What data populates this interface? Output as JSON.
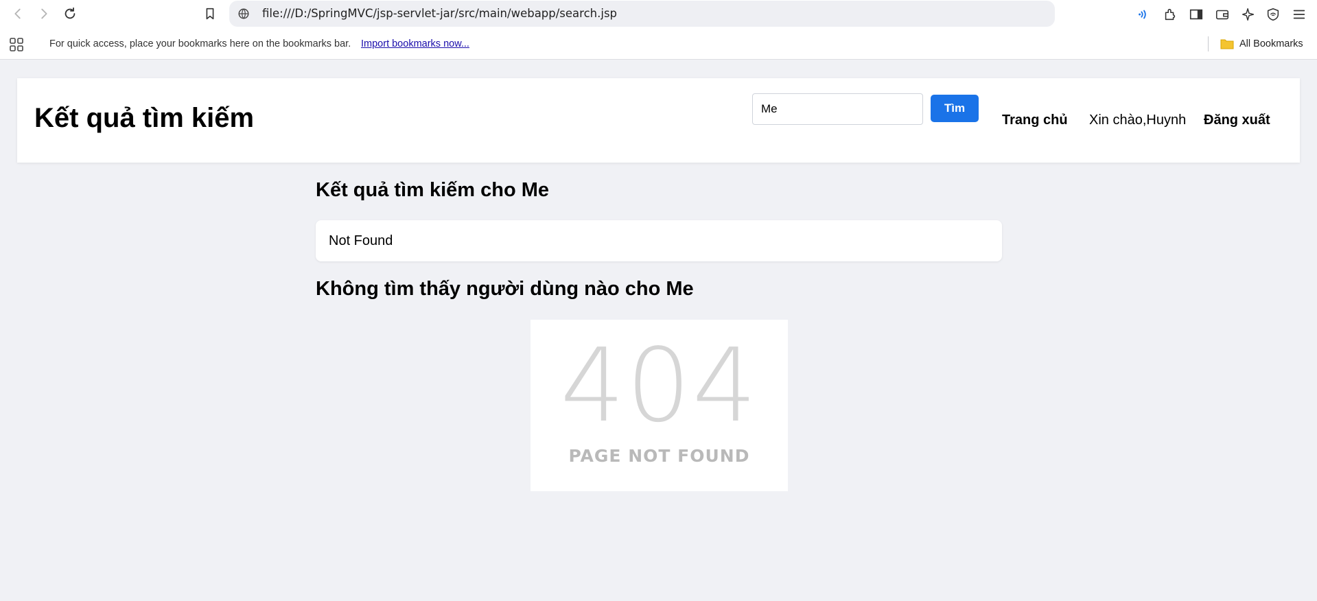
{
  "browser": {
    "url": "file:///D:/SpringMVC/jsp-servlet-jar/src/main/webapp/search.jsp",
    "bookmarks_hint": "For quick access, place your bookmarks here on the bookmarks bar.",
    "import_link": "Import bookmarks now...",
    "all_bookmarks": "All Bookmarks",
    "icons": [
      "back-icon",
      "forward-icon",
      "reload-icon",
      "bookmark-icon",
      "site-info-icon",
      "read-aloud-icon",
      "extensions-icon",
      "sidebar-icon",
      "wallet-icon",
      "copilot-icon",
      "shield-icon",
      "menu-icon",
      "apps-icon",
      "folder-icon"
    ],
    "accent": "#1a73e8"
  },
  "header": {
    "title": "Kết quả tìm kiếm",
    "search_value": "Me",
    "search_button": "Tìm",
    "nav_home": "Trang chủ",
    "greeting": "Xin chào,Huynh",
    "logout": "Đăng xuất"
  },
  "main": {
    "results_heading": "Kết quả tìm kiếm cho Me",
    "result_card_text": "Not Found",
    "empty_heading": "Không tìm thấy người dùng nào cho Me",
    "not_found_code": "404",
    "not_found_text": "PAGE NOT FOUND"
  }
}
